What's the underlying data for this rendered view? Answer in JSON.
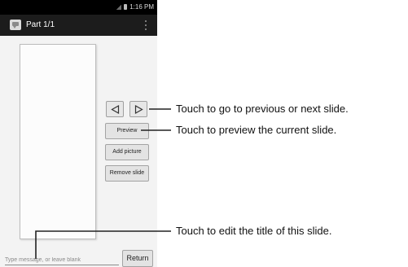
{
  "status_bar": {
    "time": "1:16 PM"
  },
  "action_bar": {
    "title": "Part 1/1"
  },
  "slide_controls": {
    "previous_icon": "triangle-left-icon",
    "next_icon": "triangle-right-icon",
    "preview_label": "Preview",
    "add_picture_label": "Add picture",
    "remove_slide_label": "Remove slide"
  },
  "compose": {
    "placeholder": "Type message, or leave blank",
    "value": "",
    "return_label": "Return"
  },
  "callouts": {
    "navigate": "Touch to go to previous or next slide.",
    "preview": "Touch to preview the current slide.",
    "edit_title": "Touch to edit the title of this slide."
  },
  "colors": {
    "status_bar": "#000000",
    "action_bar": "#1c1c1c",
    "screen_background": "#f3f3f3",
    "button_background": "#e3e3e3"
  }
}
